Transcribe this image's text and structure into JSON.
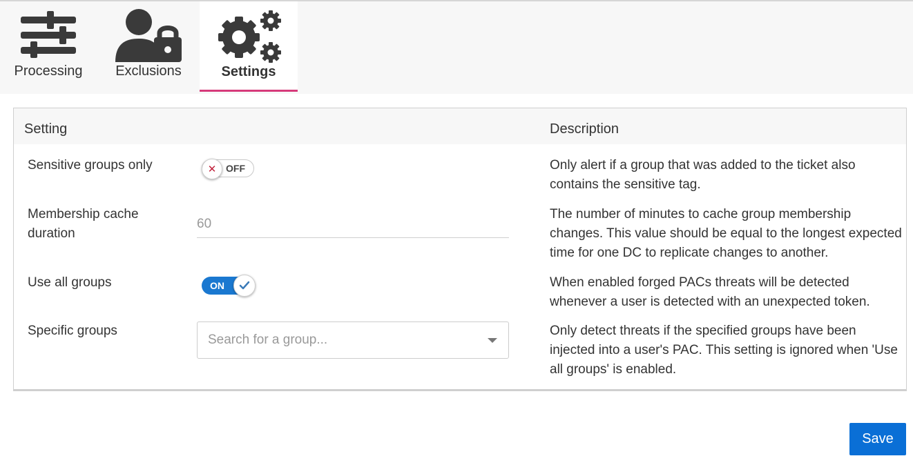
{
  "tabs": [
    {
      "label": "Processing",
      "icon": "sliders-icon",
      "active": false
    },
    {
      "label": "Exclusions",
      "icon": "user-lock-icon",
      "active": false
    },
    {
      "label": "Settings",
      "icon": "gears-icon",
      "active": true
    }
  ],
  "table": {
    "header_setting": "Setting",
    "header_description": "Description",
    "rows": [
      {
        "label": "Sensitive groups only",
        "control": "toggle",
        "state_text": "OFF",
        "description": "Only alert if a group that was added to the ticket also contains the sensitive tag."
      },
      {
        "label": "Membership cache duration",
        "control": "number",
        "value": "60",
        "description": "The number of minutes to cache group membership changes. This value should be equal to the longest expected time for one DC to replicate changes to another."
      },
      {
        "label": "Use all groups",
        "control": "toggle",
        "state_text": "ON",
        "description": "When enabled forged PACs threats will be detected whenever a user is detected with an unexpected token."
      },
      {
        "label": "Specific groups",
        "control": "select",
        "placeholder": "Search for a group...",
        "description": "Only detect threats if the specified groups have been injected into a user's PAC. This setting is ignored when 'Use all groups' is enabled."
      }
    ]
  },
  "save_label": "Save",
  "colors": {
    "accent_underline": "#d63a7a",
    "toggle_on": "#1a78d0",
    "save_button": "#0a6fd6",
    "off_x": "#c0203a"
  }
}
